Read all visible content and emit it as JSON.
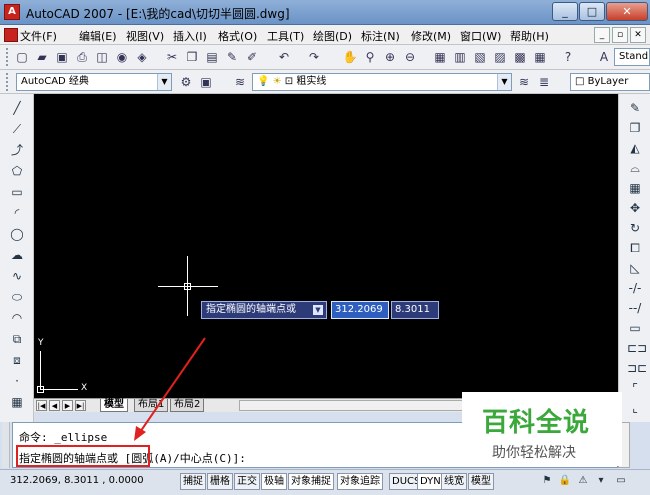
{
  "window": {
    "app_title": "AutoCAD 2007 - [E:\\我的cad\\切切半圆圆.dwg]",
    "min_glyph": "_",
    "max_glyph": "□",
    "close_glyph": "✕"
  },
  "menu": {
    "items": [
      "文件(F)",
      "编辑(E)",
      "视图(V)",
      "插入(I)",
      "格式(O)",
      "工具(T)",
      "绘图(D)",
      "标注(N)",
      "修改(M)",
      "窗口(W)",
      "帮助(H)"
    ],
    "child_min": "_",
    "child_restore": "▫",
    "child_close": "✕"
  },
  "toolbar": {
    "text_style_value": "Stand",
    "workspace_value": "AutoCAD 经典",
    "layer_value": "粗实线",
    "color_value": "ByLayer"
  },
  "drawing": {
    "dyn_prompt": "指定椭圆的轴端点或",
    "dyn_x_value": "312.2069",
    "dyn_y_value": "8.3011",
    "ucs_y_label": "Y",
    "ucs_x_label": "X"
  },
  "layout_tabs": [
    "模型",
    "布局1",
    "布局2"
  ],
  "command": {
    "line1": "命令: _ellipse",
    "line2": "指定椭圆的轴端点或 [圆弧(A)/中心点(C)]:"
  },
  "watermark": {
    "title": "百科全说",
    "subtitle": "助你轻松解决"
  },
  "statusbar": {
    "coordinates": "312.2069,  8.3011  , 0.0000",
    "toggles": [
      "捕捉",
      "栅格",
      "正交",
      "极轴",
      "对象捕捉",
      "对象追踪",
      "DUCS",
      "DYN",
      "线宽",
      "模型"
    ]
  },
  "colors": {
    "highlight": "#e0211f",
    "watermark_green": "#3aa83a",
    "canvas": "#000000"
  }
}
